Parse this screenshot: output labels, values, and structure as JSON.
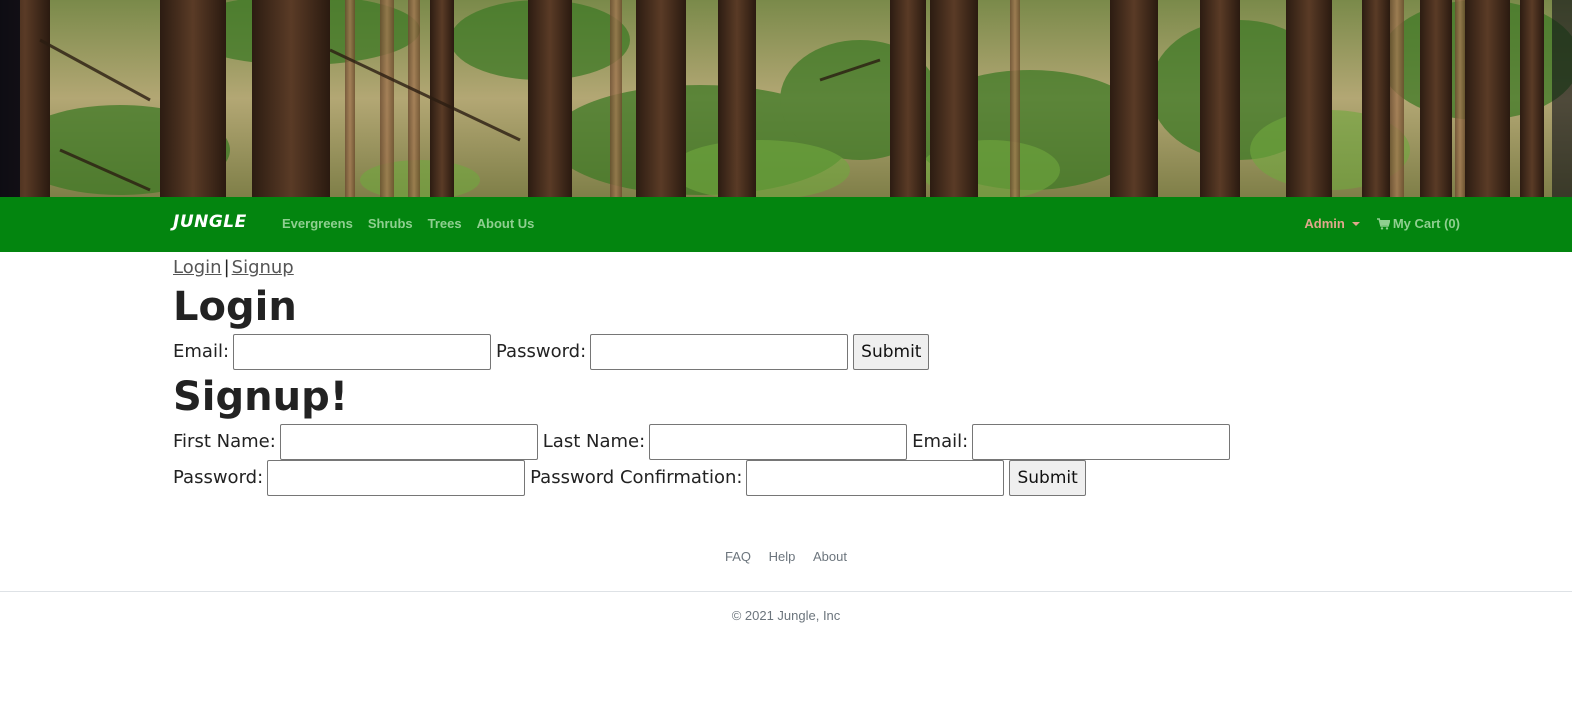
{
  "navbar": {
    "brand": "JUNGLE",
    "links": [
      "Evergreens",
      "Shrubs",
      "Trees",
      "About Us"
    ],
    "admin_label": "Admin",
    "cart_label": "My Cart (0)"
  },
  "breadcrumb": {
    "login": "Login",
    "separator": "|",
    "signup": "Signup"
  },
  "login": {
    "heading": "Login",
    "email_label": "Email:",
    "email_value": "",
    "password_label": "Password:",
    "password_value": "",
    "submit_label": "Submit"
  },
  "signup": {
    "heading": "Signup!",
    "first_name_label": "First Name:",
    "last_name_label": "Last Name:",
    "email_label": "Email:",
    "password_label": "Password:",
    "password_confirmation_label": "Password Confirmation:",
    "submit_label": "Submit"
  },
  "footer": {
    "links": [
      "FAQ",
      "Help",
      "About"
    ],
    "copyright": "© 2021 Jungle, Inc"
  },
  "colors": {
    "navbar": "#03850f",
    "nav_link": "#8fcf90",
    "admin": "#e0a78c",
    "footer_text": "#6c757d"
  },
  "icons": {
    "cart": "shopping-cart-icon",
    "admin_dropdown": "caret-down-icon"
  }
}
